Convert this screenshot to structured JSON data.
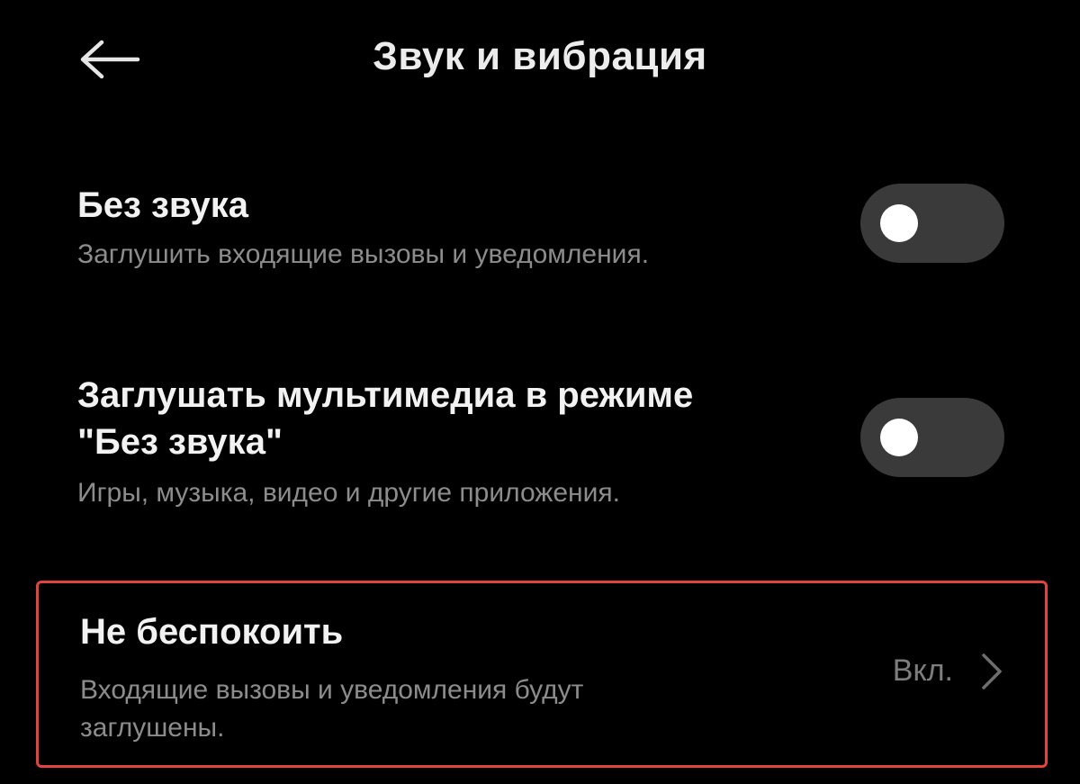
{
  "header": {
    "title": "Звук и вибрация",
    "back_icon": "arrow-left-icon"
  },
  "settings": [
    {
      "title": "Без звука",
      "subtitle": "Заглушить входящие вызовы и уведомления.",
      "control": "toggle",
      "enabled": false
    },
    {
      "title_line1": "Заглушать мультимедиа в режиме",
      "title_line2": "\"Без звука\"",
      "subtitle": "Игры, музыка, видео и другие приложения.",
      "control": "toggle",
      "enabled": false
    },
    {
      "title": "Не беспокоить",
      "subtitle_line1": "Входящие вызовы и уведомления будут",
      "subtitle_line2": "заглушены.",
      "value": "Вкл.",
      "control": "chevron",
      "highlight_color": "#e0443e"
    }
  ],
  "colors": {
    "background": "#000000",
    "title_text": "#f2f2f2",
    "subtitle_text": "#8c8c8c",
    "toggle_track": "#3a3a3a",
    "toggle_knob": "#ffffff"
  }
}
